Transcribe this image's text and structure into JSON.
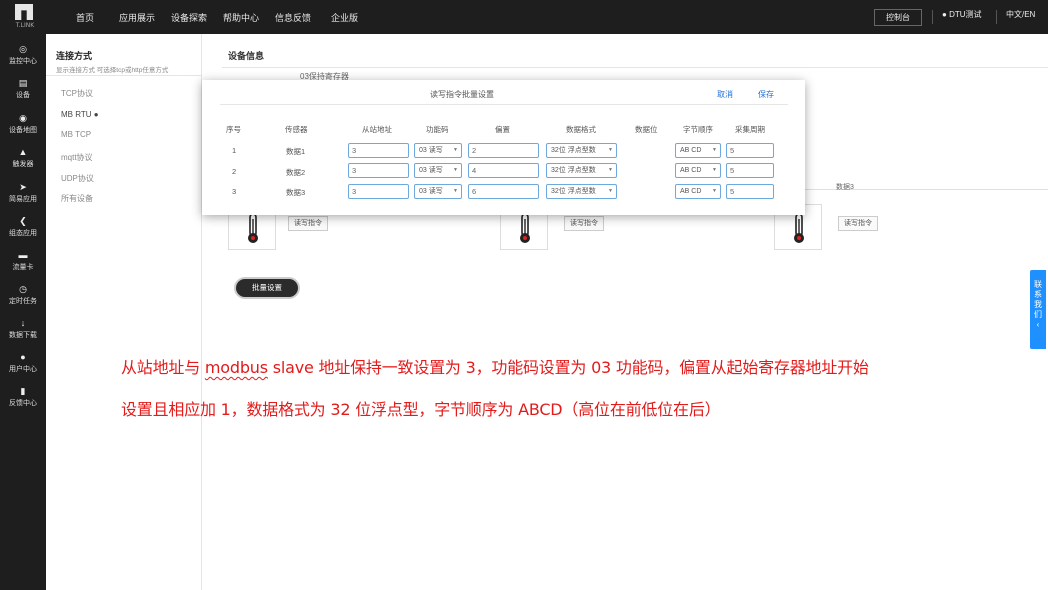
{
  "header": {
    "logo_text": "T.LINK",
    "nav": [
      "首页",
      "应用展示",
      "设备探索",
      "帮助中心",
      "信息反馈",
      "企业版"
    ],
    "console_label": "控制台",
    "user_label": "DTU测试",
    "lang_label": "中文/EN"
  },
  "sidebar": {
    "items": [
      {
        "label": "监控中心",
        "icon": "monitor-icon"
      },
      {
        "label": "设备",
        "icon": "device-icon"
      },
      {
        "label": "设备地图",
        "icon": "map-pin-icon"
      },
      {
        "label": "触发器",
        "icon": "bell-icon"
      },
      {
        "label": "简易应用",
        "icon": "send-icon"
      },
      {
        "label": "组态应用",
        "icon": "config-icon"
      },
      {
        "label": "流量卡",
        "icon": "card-icon"
      },
      {
        "label": "定时任务",
        "icon": "clock-icon"
      },
      {
        "label": "数据下载",
        "icon": "download-icon"
      },
      {
        "label": "用户中心",
        "icon": "user-icon"
      },
      {
        "label": "反馈中心",
        "icon": "message-icon"
      }
    ]
  },
  "connection": {
    "title": "连接方式",
    "subtitle": "显示连接方式 可选择tcp或http任意方式",
    "items": [
      "TCP协议",
      "MB RTU ●",
      "MB TCP",
      "mqtt协议",
      "UDP协议",
      "所有设备"
    ],
    "active_index": 1
  },
  "main": {
    "title": "设备信息",
    "register_title": "03保持寄存器",
    "sensor_visible_name": "数据3",
    "rw_button": "读写指令",
    "batch_button": "批量设置"
  },
  "modal": {
    "title": "读写指令批量设置",
    "cancel": "取消",
    "save": "保存",
    "columns": [
      "序号",
      "传感器",
      "从站地址",
      "功能码",
      "偏置",
      "数据格式",
      "数据位",
      "字节顺序",
      "采集周期"
    ],
    "rows": [
      {
        "index": "1",
        "sensor": "数据1",
        "slave": "3",
        "func": "03 读写",
        "offset": "2",
        "format": "32位 浮点型数",
        "byte_order": "AB CD",
        "period": "5"
      },
      {
        "index": "2",
        "sensor": "数据2",
        "slave": "3",
        "func": "03 读写",
        "offset": "4",
        "format": "32位 浮点型数",
        "byte_order": "AB CD",
        "period": "5"
      },
      {
        "index": "3",
        "sensor": "数据3",
        "slave": "3",
        "func": "03 读写",
        "offset": "6",
        "format": "32位 浮点型数",
        "byte_order": "AB CD",
        "period": "5"
      }
    ]
  },
  "annotation": {
    "line1_a": "从站地址与 ",
    "line1_b": "modbus",
    "line1_c": " slave 地址保持一致设置为 3，功能码设置为 03 功能码，偏置从起始寄存器地址开始",
    "line2": "设置且相应加 1，数据格式为 32 位浮点型，字节顺序为 ABCD（高位在前低位在后）"
  },
  "contact": "联系我们"
}
